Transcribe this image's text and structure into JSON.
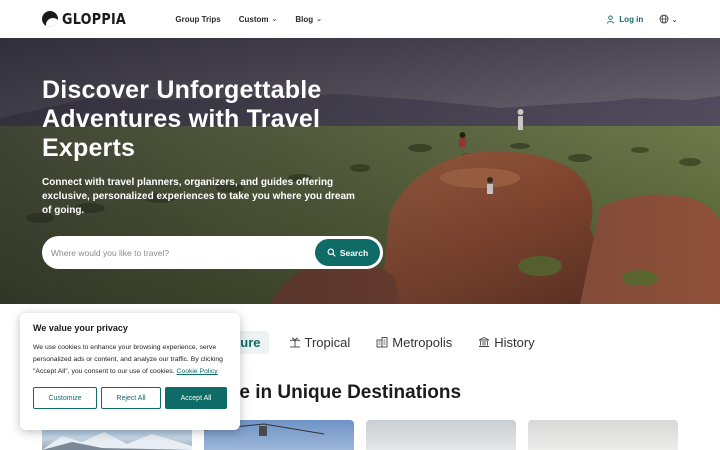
{
  "brand": {
    "name": "GLOPPIA"
  },
  "nav": {
    "links": [
      {
        "label": "Group Trips",
        "has_dropdown": false
      },
      {
        "label": "Custom",
        "has_dropdown": true
      },
      {
        "label": "Blog",
        "has_dropdown": true
      }
    ],
    "login_label": "Log in",
    "language_icon": "globe-icon"
  },
  "hero": {
    "title": "Discover Unforgettable Adventures with Travel Experts",
    "subtitle": "Connect with travel planners, organizers, and guides offering exclusive, personalized experiences to take you where you dream of going."
  },
  "search": {
    "placeholder": "Where would you like to travel?",
    "value": "",
    "button_label": "Search"
  },
  "categories": [
    {
      "label": "Adventure",
      "icon": "backpack-icon",
      "active": true,
      "visible_label": "nture"
    },
    {
      "label": "Tropical",
      "icon": "island-icon",
      "active": false,
      "visible_label": "Tropical"
    },
    {
      "label": "Metropolis",
      "icon": "buildings-icon",
      "active": false,
      "visible_label": "Metropolis"
    },
    {
      "label": "History",
      "icon": "landmark-icon",
      "active": false,
      "visible_label": "History"
    }
  ],
  "section": {
    "visible_title": "re in Unique Destinations"
  },
  "cookie": {
    "title": "We value your privacy",
    "body": "We use cookies to enhance your browsing experience, serve personalized ads or content, and analyze our traffic. By clicking \"Accept All\", you consent to our use of cookies.",
    "policy_link": "Cookie Policy",
    "buttons": {
      "customize": "Customize",
      "reject": "Reject All",
      "accept": "Accept All"
    }
  },
  "colors": {
    "accent": "#0f6b66",
    "text": "#1b1b1b"
  }
}
